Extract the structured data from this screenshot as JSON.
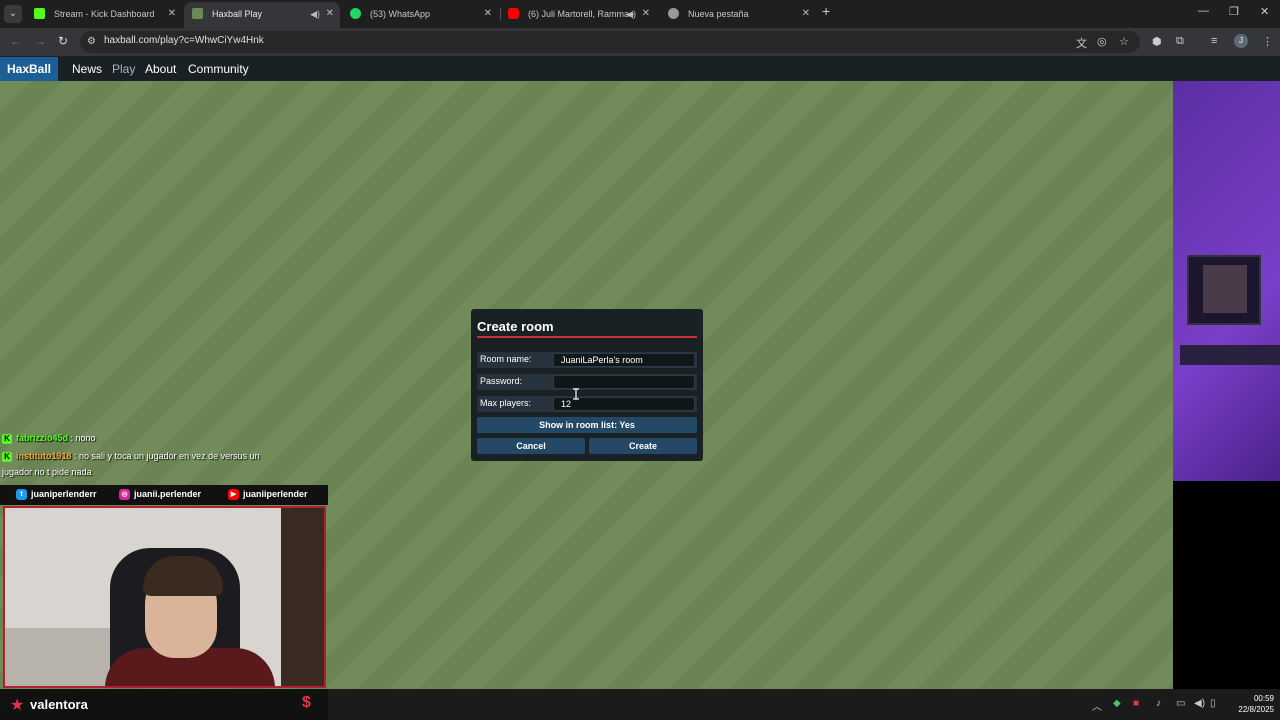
{
  "browser": {
    "tabs": [
      {
        "title": "Stream - Kick Dashboard",
        "favicon_color": "#53fc18"
      },
      {
        "title": "Haxball Play",
        "favicon_color": "#6b8a55"
      },
      {
        "title": "(53) WhatsApp",
        "favicon_color": "#25d366"
      },
      {
        "title": "(6) Juli Martorell, Ramma -",
        "favicon_color": "#ff0000"
      },
      {
        "title": "Nueva pestaña",
        "favicon_color": "#999999"
      }
    ],
    "url": "haxball.com/play?c=WhwCiYw4Hnk"
  },
  "haxball_nav": {
    "brand": "HaxBall",
    "links": [
      "News",
      "Play",
      "About",
      "Community"
    ]
  },
  "dialog": {
    "title": "Create room",
    "room_name_label": "Room name:",
    "room_name_value": "JuaniLaPerla's room",
    "password_label": "Password:",
    "password_value": "",
    "max_players_label": "Max players:",
    "max_players_value": "12",
    "show_in_list_label": "Show in room list: Yes",
    "cancel_label": "Cancel",
    "create_label": "Create"
  },
  "chat": {
    "messages": [
      {
        "user": "fabrizzio45d",
        "text": " : nono"
      },
      {
        "user": "instituto1918",
        "text": " : no sali y toca un jugador en vez de versus un"
      },
      {
        "continuation": "jugador no t pide nada"
      }
    ]
  },
  "stream_overlay": {
    "socials": [
      {
        "network": "twitter",
        "handle": "juaniperlenderr"
      },
      {
        "network": "instagram",
        "handle": "juanii.perlender"
      },
      {
        "network": "youtube",
        "handle": "juaniiperlender"
      }
    ],
    "footer_name": "valentora"
  },
  "taskbar": {
    "time": "00:59",
    "date": "22/8/2025"
  },
  "colors": {
    "haxball_brand": "#1e5e96",
    "dialog_button": "#244967",
    "dialog_rule": "#c13535",
    "kick_green": "#53fc18"
  }
}
